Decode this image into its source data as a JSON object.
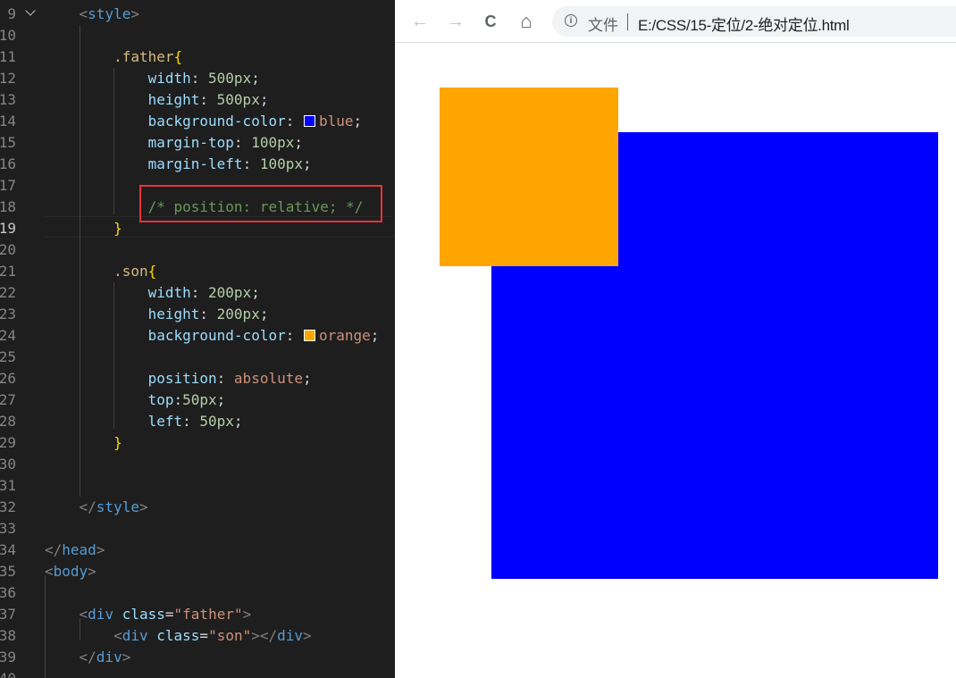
{
  "editor": {
    "lines": [
      {
        "n": "9",
        "tokens": [
          [
            "    ",
            "p"
          ],
          [
            "<",
            "tag"
          ],
          [
            "style",
            "tn"
          ],
          [
            ">",
            "tag"
          ]
        ]
      },
      {
        "n": "10",
        "tokens": []
      },
      {
        "n": "11",
        "tokens": [
          [
            "        ",
            "p"
          ],
          [
            ".father",
            "sel"
          ],
          [
            "{",
            "br"
          ]
        ]
      },
      {
        "n": "12",
        "tokens": [
          [
            "            ",
            "p"
          ],
          [
            "width",
            "prop"
          ],
          [
            ": ",
            "p"
          ],
          [
            "500px",
            "num"
          ],
          [
            ";",
            "p"
          ]
        ]
      },
      {
        "n": "13",
        "tokens": [
          [
            "            ",
            "p"
          ],
          [
            "height",
            "prop"
          ],
          [
            ": ",
            "p"
          ],
          [
            "500px",
            "num"
          ],
          [
            ";",
            "p"
          ]
        ]
      },
      {
        "n": "14",
        "tokens": [
          [
            "            ",
            "p"
          ],
          [
            "background-color",
            "prop"
          ],
          [
            ": ",
            "p"
          ],
          [
            "#0000ff",
            "swatch"
          ],
          [
            "blue",
            "val"
          ],
          [
            ";",
            "p"
          ]
        ]
      },
      {
        "n": "15",
        "tokens": [
          [
            "            ",
            "p"
          ],
          [
            "margin-top",
            "prop"
          ],
          [
            ": ",
            "p"
          ],
          [
            "100px",
            "num"
          ],
          [
            ";",
            "p"
          ]
        ]
      },
      {
        "n": "16",
        "tokens": [
          [
            "            ",
            "p"
          ],
          [
            "margin-left",
            "prop"
          ],
          [
            ": ",
            "p"
          ],
          [
            "100px",
            "num"
          ],
          [
            ";",
            "p"
          ]
        ]
      },
      {
        "n": "17",
        "tokens": []
      },
      {
        "n": "18",
        "tokens": [
          [
            "            ",
            "p"
          ],
          [
            "/* position: relative; */",
            "com"
          ]
        ]
      },
      {
        "n": "19",
        "tokens": [
          [
            "        ",
            "p"
          ],
          [
            "}",
            "br"
          ]
        ],
        "current": true
      },
      {
        "n": "20",
        "tokens": []
      },
      {
        "n": "21",
        "tokens": [
          [
            "        ",
            "p"
          ],
          [
            ".son",
            "sel"
          ],
          [
            "{",
            "br"
          ]
        ]
      },
      {
        "n": "22",
        "tokens": [
          [
            "            ",
            "p"
          ],
          [
            "width",
            "prop"
          ],
          [
            ": ",
            "p"
          ],
          [
            "200px",
            "num"
          ],
          [
            ";",
            "p"
          ]
        ]
      },
      {
        "n": "23",
        "tokens": [
          [
            "            ",
            "p"
          ],
          [
            "height",
            "prop"
          ],
          [
            ": ",
            "p"
          ],
          [
            "200px",
            "num"
          ],
          [
            ";",
            "p"
          ]
        ]
      },
      {
        "n": "24",
        "tokens": [
          [
            "            ",
            "p"
          ],
          [
            "background-color",
            "prop"
          ],
          [
            ": ",
            "p"
          ],
          [
            "#ffa500",
            "swatch"
          ],
          [
            "orange",
            "val"
          ],
          [
            ";",
            "p"
          ]
        ]
      },
      {
        "n": "25",
        "tokens": []
      },
      {
        "n": "26",
        "tokens": [
          [
            "            ",
            "p"
          ],
          [
            "position",
            "prop"
          ],
          [
            ": ",
            "p"
          ],
          [
            "absolute",
            "val"
          ],
          [
            ";",
            "p"
          ]
        ]
      },
      {
        "n": "27",
        "tokens": [
          [
            "            ",
            "p"
          ],
          [
            "top",
            "prop"
          ],
          [
            ":",
            "p"
          ],
          [
            "50px",
            "num"
          ],
          [
            ";",
            "p"
          ]
        ]
      },
      {
        "n": "28",
        "tokens": [
          [
            "            ",
            "p"
          ],
          [
            "left",
            "prop"
          ],
          [
            ": ",
            "p"
          ],
          [
            "50px",
            "num"
          ],
          [
            ";",
            "p"
          ]
        ]
      },
      {
        "n": "29",
        "tokens": [
          [
            "        ",
            "p"
          ],
          [
            "}",
            "br"
          ]
        ]
      },
      {
        "n": "30",
        "tokens": []
      },
      {
        "n": "31",
        "tokens": []
      },
      {
        "n": "32",
        "tokens": [
          [
            "    ",
            "p"
          ],
          [
            "</",
            "tag"
          ],
          [
            "style",
            "tn"
          ],
          [
            ">",
            "tag"
          ]
        ]
      },
      {
        "n": "33",
        "tokens": []
      },
      {
        "n": "34",
        "tokens": [
          [
            "</",
            "tag"
          ],
          [
            "head",
            "tn"
          ],
          [
            ">",
            "tag"
          ]
        ]
      },
      {
        "n": "35",
        "tokens": [
          [
            "<",
            "tag"
          ],
          [
            "body",
            "tn"
          ],
          [
            ">",
            "tag"
          ]
        ]
      },
      {
        "n": "36",
        "tokens": []
      },
      {
        "n": "37",
        "tokens": [
          [
            "    ",
            "p"
          ],
          [
            "<",
            "tag"
          ],
          [
            "div",
            "tn"
          ],
          [
            " ",
            "p"
          ],
          [
            "class",
            "attr"
          ],
          [
            "=",
            "p"
          ],
          [
            "\"father\"",
            "str"
          ],
          [
            ">",
            "tag"
          ]
        ]
      },
      {
        "n": "38",
        "tokens": [
          [
            "        ",
            "p"
          ],
          [
            "<",
            "tag"
          ],
          [
            "div",
            "tn"
          ],
          [
            " ",
            "p"
          ],
          [
            "class",
            "attr"
          ],
          [
            "=",
            "p"
          ],
          [
            "\"son\"",
            "str"
          ],
          [
            "></",
            "tag"
          ],
          [
            "div",
            "tn"
          ],
          [
            ">",
            "tag"
          ]
        ]
      },
      {
        "n": "39",
        "tokens": [
          [
            "    ",
            "p"
          ],
          [
            "</",
            "tag"
          ],
          [
            "div",
            "tn"
          ],
          [
            ">",
            "tag"
          ]
        ]
      },
      {
        "n": "40",
        "tokens": []
      }
    ]
  },
  "browser": {
    "scheme_label": "文件",
    "url": "E:/CSS/15-定位/2-绝对定位.html",
    "icons": {
      "back": "←",
      "forward": "→",
      "reload": "C",
      "home": "⌂",
      "info": "i"
    },
    "colors": {
      "father": "#0000ff",
      "son": "#ffa500"
    }
  }
}
